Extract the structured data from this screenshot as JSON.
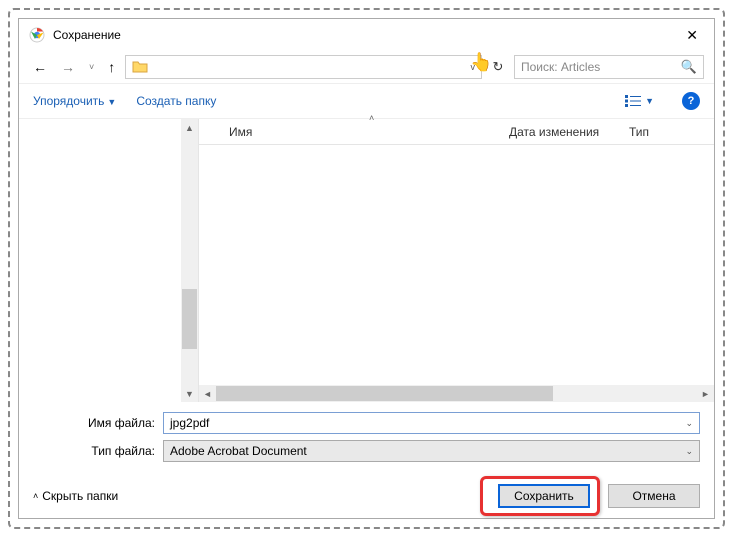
{
  "window": {
    "title": "Сохранение"
  },
  "nav": {
    "search_placeholder": "Поиск: Articles"
  },
  "toolbar": {
    "organize": "Упорядочить",
    "new_folder": "Создать папку"
  },
  "columns": {
    "name": "Имя",
    "date": "Дата изменения",
    "type": "Тип"
  },
  "form": {
    "filename_label": "Имя файла:",
    "filename_value": "jpg2pdf",
    "filetype_label": "Тип файла:",
    "filetype_value": "Adobe Acrobat Document"
  },
  "footer": {
    "hide_folders": "Скрыть папки",
    "save": "Сохранить",
    "cancel": "Отмена"
  }
}
